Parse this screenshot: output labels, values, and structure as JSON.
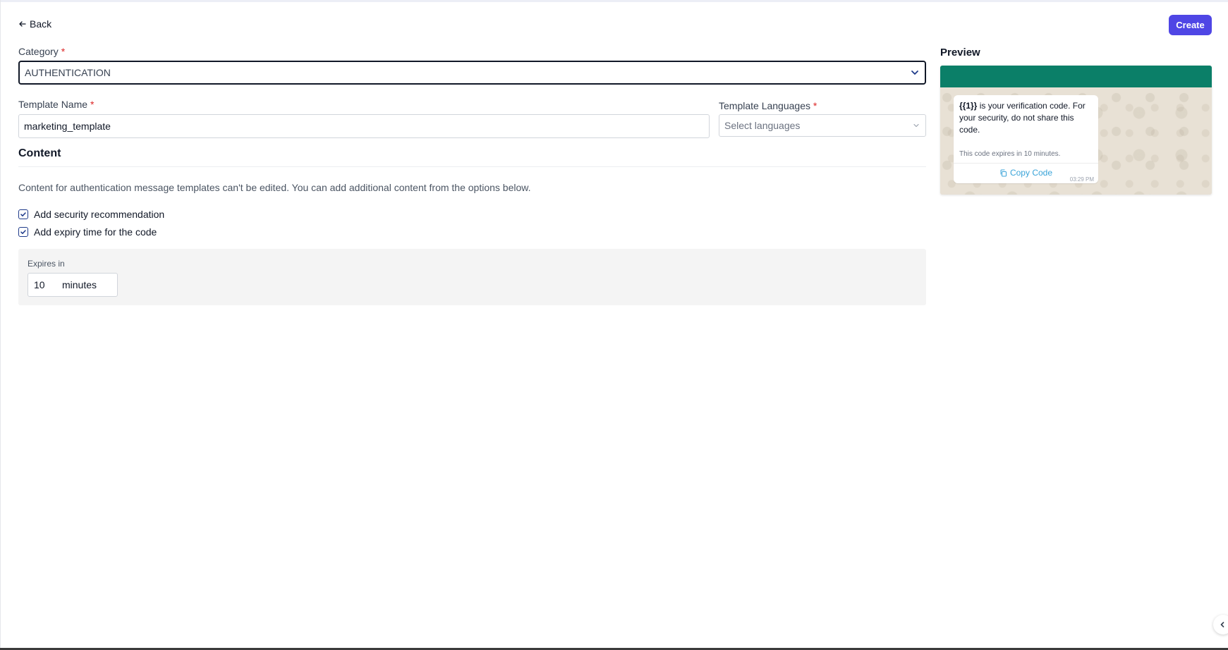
{
  "header": {
    "back_label": "Back",
    "create_label": "Create"
  },
  "form": {
    "category": {
      "label": "Category",
      "required_mark": "*",
      "value": "AUTHENTICATION"
    },
    "template_name": {
      "label": "Template Name",
      "required_mark": "*",
      "value": "marketing_template"
    },
    "template_languages": {
      "label": "Template Languages",
      "required_mark": "*",
      "placeholder": "Select languages"
    }
  },
  "content": {
    "title": "Content",
    "description": "Content for authentication message templates can't be edited. You can add additional content from the options below.",
    "options": [
      {
        "label": "Add security recommendation",
        "checked": true
      },
      {
        "label": "Add expiry time for the code",
        "checked": true
      }
    ],
    "expiry": {
      "label": "Expires in",
      "value": "10",
      "unit": "minutes"
    }
  },
  "preview": {
    "title": "Preview",
    "message_variable": "{{1}}",
    "message_rest": " is your verification code. For your security, do not share this code.",
    "expiry_note": "This code expires in 10 minutes.",
    "button_label": "Copy Code",
    "time": "03:29 PM"
  },
  "colors": {
    "primary": "#4f46e5",
    "whatsapp_header": "#0b7f68",
    "copy_link": "#38a3d8",
    "required": "#dc2626"
  }
}
